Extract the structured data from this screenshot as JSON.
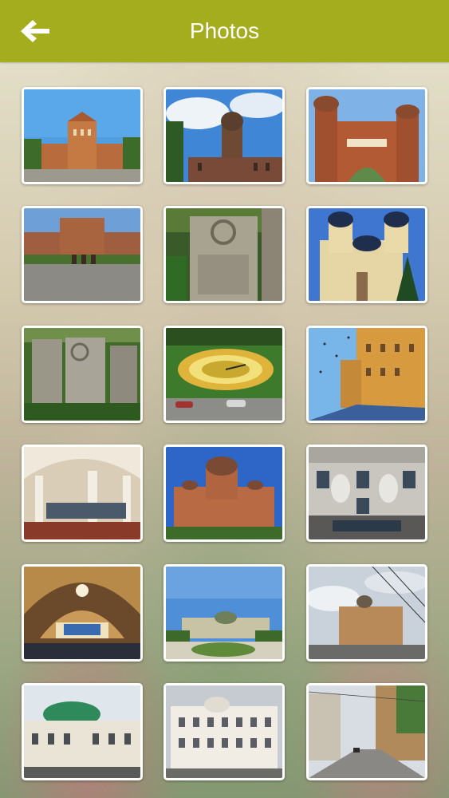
{
  "header": {
    "title": "Photos",
    "back_icon": "back-arrow-icon",
    "color": "#a3ad1e"
  },
  "photos": [
    {
      "name": "university-residence"
    },
    {
      "name": "church-dome-clouds"
    },
    {
      "name": "university-gate"
    },
    {
      "name": "university-courtyard"
    },
    {
      "name": "stone-carving"
    },
    {
      "name": "yellow-cathedral"
    },
    {
      "name": "stone-monuments"
    },
    {
      "name": "flower-clock"
    },
    {
      "name": "street-birds"
    },
    {
      "name": "marble-hall"
    },
    {
      "name": "red-brick-church"
    },
    {
      "name": "building-facade-atlantes"
    },
    {
      "name": "golden-hall-interior"
    },
    {
      "name": "theatre-square"
    },
    {
      "name": "domed-corner-building"
    },
    {
      "name": "green-dome-station"
    },
    {
      "name": "white-domed-building"
    },
    {
      "name": "old-street"
    }
  ]
}
